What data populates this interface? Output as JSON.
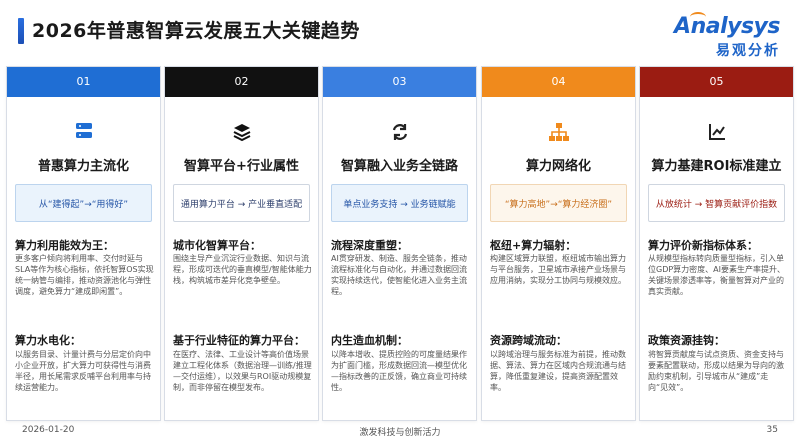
{
  "page": {
    "title": "2026年普惠智算云发展五大关键趋势",
    "logo_en": "Analysys",
    "logo_cn": "易观分析",
    "footer_date": "2026-01-20",
    "footer_center": "激发科技与创新活力",
    "page_number": "35"
  },
  "columns": [
    {
      "num": "01",
      "color": "#1f6ed4",
      "title": "普惠算力主流化",
      "tag": "从“建得起”→“用得好”",
      "h1": "算力利用能效为王：",
      "p1": "更多客户倾向将利用率、交付时延与SLA等作为核心指标，依托智算OS实现统一纳管与编排，推动资源池化与弹性调度，避免算力“建成即闲置”。",
      "h2": "算力水电化：",
      "p2": "以服务目录、计量计费与分层定价向中小企业开放，扩大算力可获得性与消费半径，用长尾需求反哺平台利用率与持续运营能力。"
    },
    {
      "num": "02",
      "color": "#111111",
      "title": "智算平台+行业属性",
      "tag": "通用算力平台 → 产业垂直适配",
      "h1": "城市化智算平台：",
      "p1": "围绕主导产业沉淀行业数据、知识与流程，形成可迭代的垂直模型/智能体能力栈，构筑城市差异化竞争壁垒。",
      "h2": "基于行业特征的算力平台：",
      "p2": "在医疗、法律、工业设计等高价值场景建立工程化体系（数据治理—训练/推理—交付运维），以效果与ROI驱动规模复制，而非停留在模型发布。"
    },
    {
      "num": "03",
      "color": "#3a7fe0",
      "title": "智算融入业务全链路",
      "tag": "单点业务支持 → 业务链赋能",
      "h1": "流程深度重塑：",
      "p1": "AI贯穿研发、制造、服务全链条，推动流程标准化与自动化，并通过数据回流实现持续迭代，使智能化进入业务主流程。",
      "h2": "内生造血机制：",
      "p2": "以降本增收、提质控险的可度量结果作为扩面门槛，形成数据回流—模型优化—指标改善的正反馈，确立商业可持续性。"
    },
    {
      "num": "04",
      "color": "#f08a1c",
      "title": "算力网络化",
      "tag": "“算力高地”→“算力经济圈”",
      "h1": "枢纽+算力辐射：",
      "p1": "构建区域算力联盟，枢纽城市输出算力与平台服务，卫星城市承接产业场景与应用消纳，实现分工协同与规模效应。",
      "h2": "资源跨域流动：",
      "p2": "以跨域治理与服务标准为前提，推动数据、算法、算力在区域内合规流通与结算，降低重复建设，提高资源配置效率。"
    },
    {
      "num": "05",
      "color": "#9b1c12",
      "title": "算力基建ROI标准建立",
      "tag": "从放统计 → 智算贡献评价指数",
      "h1": "算力评价新指标体系：",
      "p1": "从规模型指标转向质量型指标，引入单位GDP算力密度、AI要素生产率提升、关键场景渗透率等，衡量智算对产业的真实贡献。",
      "h2": "政策资源挂钩：",
      "p2": "将智算贡献度与试点资质、资金支持与要素配置联动，形成以结果为导向的激励约束机制，引导城市从“建成”走向“见效”。"
    }
  ]
}
